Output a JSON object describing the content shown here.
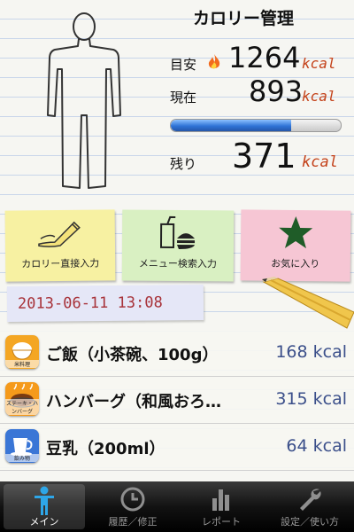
{
  "header": {
    "title": "カロリー管理"
  },
  "summary": {
    "target": {
      "label": "目安",
      "value": "1264",
      "unit": "kcal"
    },
    "current": {
      "label": "現在",
      "value": "893",
      "unit": "kcal"
    },
    "remaining": {
      "label": "残り",
      "value": "371",
      "unit": "kcal"
    },
    "progress": 0.71
  },
  "quick_actions": [
    {
      "label": "カロリー直接入力",
      "icon": "pencil-hand-icon",
      "color": "#f7f1a2"
    },
    {
      "label": "メニュー検索入力",
      "icon": "fastfood-icon",
      "color": "#d9f0c2"
    },
    {
      "label": "お気に入り",
      "icon": "star-icon",
      "color": "#f6c6d4"
    }
  ],
  "datetime": "2013-06-11 13:08",
  "foods": [
    {
      "name": "ご飯（小茶碗、100g）",
      "kcal": "168 kcal",
      "icon": "rice-bowl-icon",
      "icon_label": "米料理",
      "icon_color": "#f4a623"
    },
    {
      "name": "ハンバーグ（和風おろ…",
      "kcal": "315 kcal",
      "icon": "steak-icon",
      "icon_label": "ステーキ・ハンバーグ",
      "icon_color": "#f59a1b"
    },
    {
      "name": "豆乳（200ml）",
      "kcal": "64 kcal",
      "icon": "cup-icon",
      "icon_label": "飲み物",
      "icon_color": "#3a76d6"
    }
  ],
  "tabs": [
    {
      "label": "メイン",
      "icon": "person-icon",
      "active": true
    },
    {
      "label": "履歴／修正",
      "icon": "clock-icon",
      "active": false
    },
    {
      "label": "レポート",
      "icon": "bar-chart-icon",
      "active": false
    },
    {
      "label": "設定／使い方",
      "icon": "wrench-icon",
      "active": false
    }
  ],
  "colors": {
    "unit": "#c4421a",
    "kcal_text": "#3b4f8a",
    "date_text": "#a8333a",
    "progress_fill": "#2f73d6"
  }
}
